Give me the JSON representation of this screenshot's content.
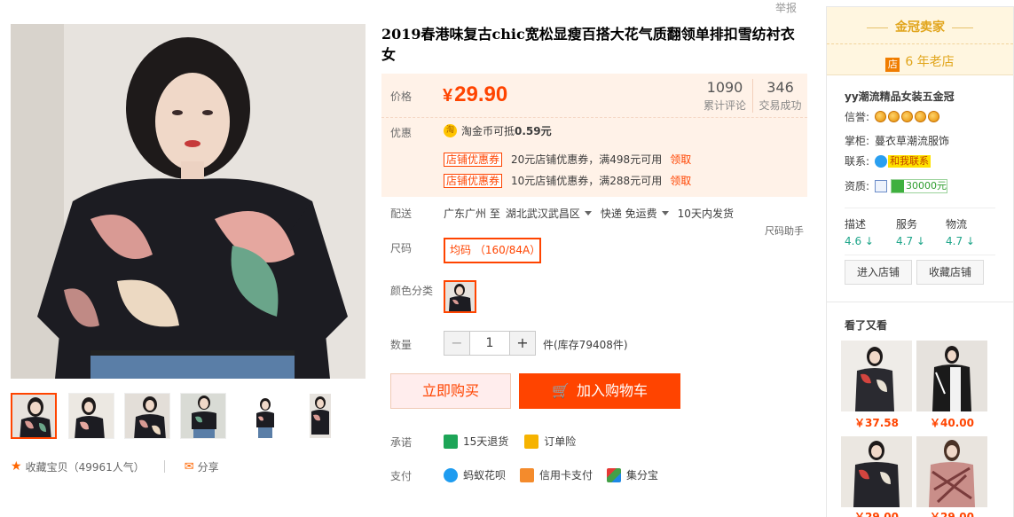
{
  "report_link": "举报",
  "gallery": {
    "thumb_count": 6,
    "selected_index": 0
  },
  "social": {
    "favorite_label": "收藏宝贝（49961人气）",
    "share_label": "分享"
  },
  "product": {
    "title": "2019春港味复古chic宽松显瘦百搭大花气质翻领单排扣雪纺衬衣女",
    "price_label": "价格",
    "currency": "¥",
    "price": "29.90",
    "reviews_count": "1090",
    "reviews_caption": "累计评论",
    "sales_count": "346",
    "sales_caption": "交易成功",
    "promo_label": "优惠",
    "coin_text": "淘金币可抵",
    "coin_amount": "0.59元",
    "coin_icon": "淘",
    "coupons": [
      {
        "tag": "店铺优惠券",
        "text": "20元店铺优惠券，满498元可用",
        "action": "领取"
      },
      {
        "tag": "店铺优惠券",
        "text": "10元店铺优惠券，满288元可用",
        "action": "领取"
      }
    ]
  },
  "shipping": {
    "label": "配送",
    "from": "广东广州 至",
    "to": "湖北武汉武昌区",
    "method": "快递 免运费",
    "eta": "10天内发货"
  },
  "size": {
    "helper": "尺码助手",
    "label": "尺码",
    "option": "均码 （160/84A）"
  },
  "color": {
    "label": "颜色分类"
  },
  "quantity": {
    "label": "数量",
    "value": "1",
    "minus": "−",
    "plus": "+",
    "stock": "件(库存79408件)"
  },
  "actions": {
    "buy_now": "立即购买",
    "add_cart": "加入购物车"
  },
  "promise": {
    "label": "承诺",
    "items": [
      {
        "icon": "seven-day-return-icon",
        "text": "15天退货"
      },
      {
        "icon": "order-insurance-icon",
        "text": "订单险"
      }
    ]
  },
  "payment": {
    "label": "支付",
    "items": [
      {
        "icon": "huabei-icon",
        "text": "蚂蚁花呗"
      },
      {
        "icon": "credit-card-icon",
        "text": "信用卡支付"
      },
      {
        "icon": "points-icon",
        "text": "集分宝"
      }
    ]
  },
  "seller": {
    "badge": "金冠卖家",
    "shop_icon": "店",
    "years": "6 年老店",
    "shop_name": "yy潮流精品女装五金冠",
    "credit_label": "信誉:",
    "crowns": 5,
    "keeper_label": "掌柜:",
    "keeper": "蔓衣草潮流服饰",
    "contact_label": "联系:",
    "contact_text": "和我联系",
    "qual_label": "资质:",
    "bond": "30000元",
    "dsr": [
      {
        "name": "描述",
        "value": "4.6 ↓"
      },
      {
        "name": "服务",
        "value": "4.7 ↓"
      },
      {
        "name": "物流",
        "value": "4.7 ↓"
      }
    ],
    "enter_shop": "进入店铺",
    "fav_shop": "收藏店铺"
  },
  "seen": {
    "title": "看了又看",
    "items": [
      {
        "price": "￥37.58"
      },
      {
        "price": "￥40.00"
      },
      {
        "price": "￥29.00"
      },
      {
        "price": "￥29.00"
      }
    ]
  },
  "colors": {
    "accent": "#ff4400",
    "gold": "#e1a51c",
    "price_bg": "#fff2e8",
    "dsr_green": "#1ea58a"
  }
}
